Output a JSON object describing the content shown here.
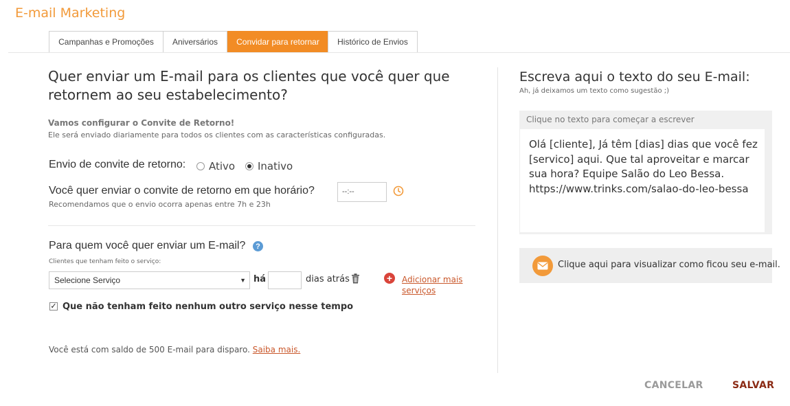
{
  "app": {
    "title": "E-mail Marketing"
  },
  "tabs": [
    {
      "label": "Campanhas e Promoções",
      "active": false
    },
    {
      "label": "Aniversários",
      "active": false
    },
    {
      "label": "Convidar para retornar",
      "active": true
    },
    {
      "label": "Histórico de Envios",
      "active": false
    }
  ],
  "left": {
    "question": "Quer enviar um E-mail para os clientes que você quer que retornem ao seu estabelecimento?",
    "config_title": "Vamos configurar o Convite de Retorno!",
    "config_subtitle": "Ele será enviado diariamente para todos os clientes com as características configuradas.",
    "status_label": "Envio de convite de retorno:",
    "status_options": {
      "active": "Ativo",
      "inactive": "Inativo",
      "selected": "Inativo"
    },
    "time_label": "Você quer enviar o convite de retorno em que horário?",
    "time_value": "--:--",
    "time_hint": "Recomendamos que o envio ocorra apenas entre 7h e 23h",
    "recipients_label": "Para quem você quer enviar um E-mail?",
    "service_hint": "Clientes que tenham feito o serviço:",
    "service_select": "Selecione Serviço",
    "ha_label": "há",
    "days_value": "",
    "days_suffix": "dias atrás",
    "add_more_line1": "Adicionar mais",
    "add_more_line2": "serviços",
    "checkbox_label": "Que não tenham feito nenhum outro serviço nesse tempo",
    "checkbox_checked": true,
    "balance_text": "Você está com saldo de 500 E-mail para disparo.",
    "learn_more": "Saiba mais."
  },
  "right": {
    "title": "Escreva aqui o texto do seu E-mail:",
    "subtitle": "Ah, já deixamos um texto como sugestão ;)",
    "editor_hint": "Clique no texto para começar a escrever",
    "message_lines": [
      "Olá [cliente], Já têm [dias] dias que você fez",
      "[servico] aqui. Que tal aproveitar e marcar",
      "sua hora? Equipe Salão do Leo Bessa.",
      "https://www.trinks.com/salao-do-leo-bessa"
    ],
    "preview_label": "Clique aqui para visualizar como ficou seu e-mail."
  },
  "actions": {
    "cancel": "CANCELAR",
    "save": "SALVAR"
  },
  "colors": {
    "accent": "#f28c25",
    "link": "#c9572a",
    "save": "#8b2a14",
    "cancel": "#9a9a9a"
  }
}
